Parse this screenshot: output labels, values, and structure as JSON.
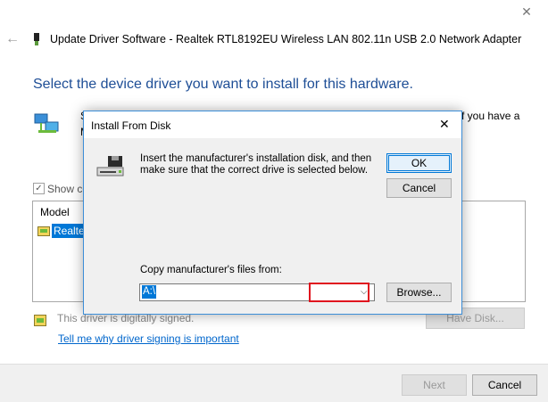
{
  "window": {
    "close_glyph": "✕",
    "back_glyph": "←",
    "title": "Update Driver Software - Realtek RTL8192EU Wireless LAN 802.11n USB 2.0 Network Adapter",
    "heading": "Select the device driver you want to install for this hardware.",
    "desc_fragment_left": "S",
    "desc_fragment_left2": "M",
    "desc_fragment_right": "f you have a"
  },
  "compat": {
    "checked_glyph": "✓",
    "label": "Show co"
  },
  "model_list": {
    "header": "Model",
    "rows": [
      {
        "label": "Realte"
      }
    ]
  },
  "driver_status": {
    "signed_text": "This driver is digitally signed.",
    "link_text": "Tell me why driver signing is important"
  },
  "buttons": {
    "have_disk": "Have Disk...",
    "next": "Next",
    "cancel": "Cancel"
  },
  "dialog": {
    "title": "Install From Disk",
    "close_glyph": "✕",
    "message": "Insert the manufacturer's installation disk, and then make sure that the correct drive is selected below.",
    "ok": "OK",
    "cancel": "Cancel",
    "copy_label": "Copy manufacturer's files from:",
    "path_value": "A:\\",
    "dropdown_glyph": "⌵",
    "browse": "Browse..."
  },
  "colors": {
    "accent": "#0078d7",
    "heading": "#1e4e96",
    "link": "#0066cc",
    "highlight_box": "#e0141e"
  }
}
